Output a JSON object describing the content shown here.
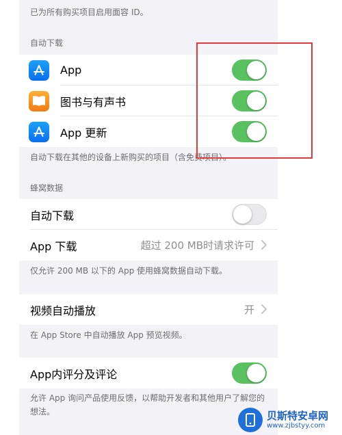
{
  "top_note": "已为所有购买项目启用面容 ID。",
  "auto_download": {
    "header": "自动下载",
    "items": [
      {
        "label": "App",
        "icon": "app-store-icon",
        "toggle": "on"
      },
      {
        "label": "图书与有声书",
        "icon": "books-icon",
        "toggle": "on"
      },
      {
        "label": "App 更新",
        "icon": "app-store-icon",
        "toggle": "on"
      }
    ],
    "footer": "自动下载在其他的设备上新购买的项目（含免费项目）。"
  },
  "cellular": {
    "header": "蜂窝数据",
    "auto_download_label": "自动下载",
    "auto_download_toggle": "off",
    "app_download_label": "App 下载",
    "app_download_value": "超过 200 MB时请求许可",
    "footer": "仅允许 200 MB 以下的 App 使用蜂窝数据自动下载。"
  },
  "video": {
    "label": "视频自动播放",
    "value": "开",
    "footer": "在 App Store 中自动播放 App 预览视频。"
  },
  "ratings": {
    "label": "App内评分及评论",
    "toggle": "on",
    "footer": "允许 App 询问产品使用反馈，以帮助开发者和其他用户了解您的想法。"
  },
  "watermark": {
    "title": "贝斯特安卓网",
    "url": "www.zjbstyy.com"
  },
  "colors": {
    "toggle_on": "#5ac160",
    "highlight_box": "#e03a3a",
    "app_store_blue": "#0b6ff0",
    "books_orange": "#f27c14"
  }
}
